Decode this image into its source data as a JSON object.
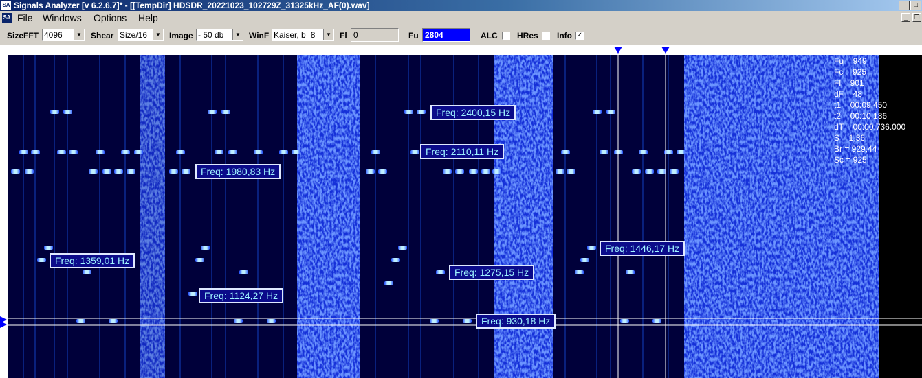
{
  "window": {
    "title": "Signals Analyzer [v 6.2.6.7]* - [[TempDir] HDSDR_20221023_102729Z_31325kHz_AF(0).wav]",
    "app_icon": "SA",
    "controls": [
      "minimize-icon",
      "maximize-icon",
      "close-icon"
    ]
  },
  "menu": {
    "mdi_icon": "SA",
    "items": [
      "File",
      "Windows",
      "Options",
      "Help"
    ]
  },
  "toolbar": {
    "sizefft": {
      "label": "SizeFFT",
      "value": "4096"
    },
    "shear": {
      "label": "Shear",
      "value": "Size/16"
    },
    "image": {
      "label": "Image",
      "value": "- 50 db"
    },
    "winf": {
      "label": "WinF",
      "value": "Kaiser, b=8"
    },
    "fl": {
      "label": "Fl",
      "value": "0"
    },
    "fu": {
      "label": "Fu",
      "value": "2804"
    },
    "alc": {
      "label": "ALC",
      "checked": false
    },
    "hres": {
      "label": "HRes",
      "checked": false
    },
    "info": {
      "label": "Info",
      "checked": true
    }
  },
  "info_panel": [
    "Fu = 949",
    "Fc = 925",
    "Fl = 901",
    "dF = 48",
    "t1 = 00:09.450",
    "t2 = 00:10.186",
    "dT = 00:00.736.000",
    "S = 1,36",
    "Br = 929,44",
    "Sc = 925"
  ],
  "freq_labels": [
    "Freq: 2400,15 Hz",
    "Freq: 2110,11 Hz",
    "Freq: 1980,83 Hz",
    "Freq: 1359,01 Hz",
    "Freq: 1446,17 Hz",
    "Freq: 1275,15 Hz",
    "Freq: 1124,27 Hz",
    "Freq: 930,18 Hz"
  ],
  "colors": {
    "spectrogram_bg": "#00003a",
    "noise": "#1a3cff",
    "tone": "#7fd0ff",
    "cursor_marker": "#0000ff",
    "label_text": "#9ff3ff"
  }
}
